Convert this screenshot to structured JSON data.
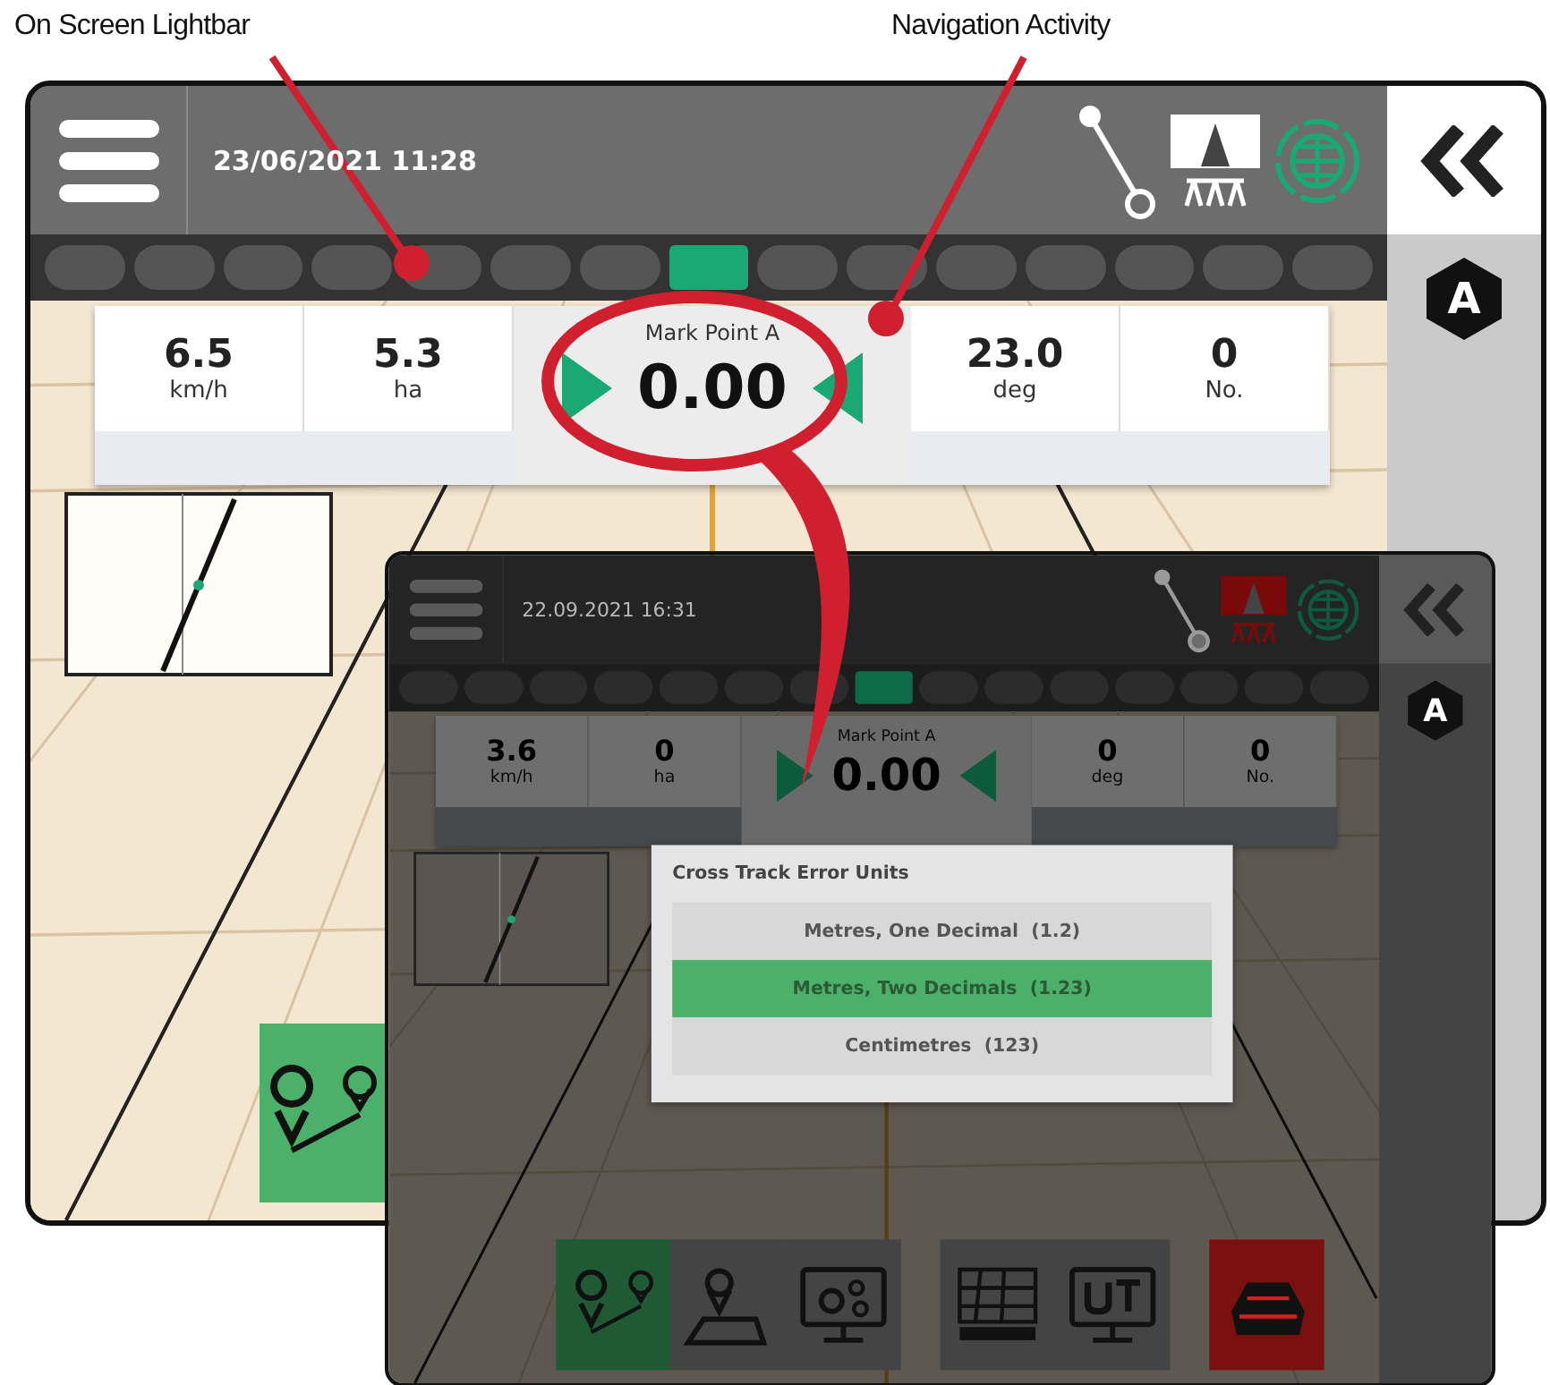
{
  "callouts": [
    {
      "label": "On Screen Lightbar"
    },
    {
      "label": "Navigation Activity"
    }
  ],
  "main_screen": {
    "date": "23/06/2021 11:28",
    "status_icons": [
      {
        "kind": "link",
        "color": "#ffffff"
      },
      {
        "kind": "sprayer",
        "color": "#ffffff"
      },
      {
        "kind": "globe",
        "color": "#1aa874"
      }
    ],
    "lightbar": [
      {
        "selected": false
      },
      {
        "selected": false
      },
      {
        "selected": false
      },
      {
        "selected": false
      },
      {
        "selected": false
      },
      {
        "selected": false
      },
      {
        "selected": false
      },
      {
        "selected": true
      },
      {
        "selected": false
      },
      {
        "selected": false
      },
      {
        "selected": false
      },
      {
        "selected": false
      },
      {
        "selected": false
      },
      {
        "selected": false
      },
      {
        "selected": false
      }
    ],
    "readouts": [
      {
        "value": "6.5",
        "unit": "km/h"
      },
      {
        "value": "5.3",
        "unit": "ha"
      },
      {
        "value": "23.0",
        "unit": "deg"
      },
      {
        "value": "0",
        "unit": "No."
      }
    ],
    "navigation": {
      "label": "Mark Point A",
      "value": "0.00"
    },
    "mode_badge": "A",
    "toolbar": [
      {
        "kind": "guidance",
        "color": "#4caf6a"
      }
    ]
  },
  "inset_screen": {
    "date": "22.09.2021 16:31",
    "status_icons": [
      {
        "kind": "link",
        "color": "#9a9a9a"
      },
      {
        "kind": "sprayer",
        "color": "#7a0a0a"
      },
      {
        "kind": "globe",
        "color": "#0e5a3e"
      }
    ],
    "lightbar": [
      {
        "selected": false
      },
      {
        "selected": false
      },
      {
        "selected": false
      },
      {
        "selected": false
      },
      {
        "selected": false
      },
      {
        "selected": false
      },
      {
        "selected": false
      },
      {
        "selected": true
      },
      {
        "selected": false
      },
      {
        "selected": false
      },
      {
        "selected": false
      },
      {
        "selected": false
      },
      {
        "selected": false
      },
      {
        "selected": false
      },
      {
        "selected": false
      }
    ],
    "readouts": [
      {
        "value": "3.6",
        "unit": "km/h"
      },
      {
        "value": "0",
        "unit": "ha"
      },
      {
        "value": "0",
        "unit": "deg"
      },
      {
        "value": "0",
        "unit": "No."
      }
    ],
    "navigation": {
      "label": "Mark Point A",
      "value": "0.00"
    },
    "mode_badge": "A",
    "toolbar": [
      {
        "kind": "guidance",
        "color": "#1f5a34"
      },
      {
        "kind": "guidance-map",
        "color": "#444444"
      },
      {
        "kind": "settings",
        "color": "#444444"
      },
      {
        "kind": "field-map",
        "color": "#444444"
      },
      {
        "kind": "ut",
        "color": "#444444"
      },
      {
        "kind": "machine",
        "color": "#7a1010"
      }
    ],
    "dialog": {
      "title": "Cross Track Error Units",
      "options": [
        {
          "label": "Metres, One Decimal  (1.2)",
          "selected": false
        },
        {
          "label": "Metres, Two Decimals  (1.23)",
          "selected": true
        },
        {
          "label": "Centimetres  (123)",
          "selected": false
        }
      ]
    }
  }
}
